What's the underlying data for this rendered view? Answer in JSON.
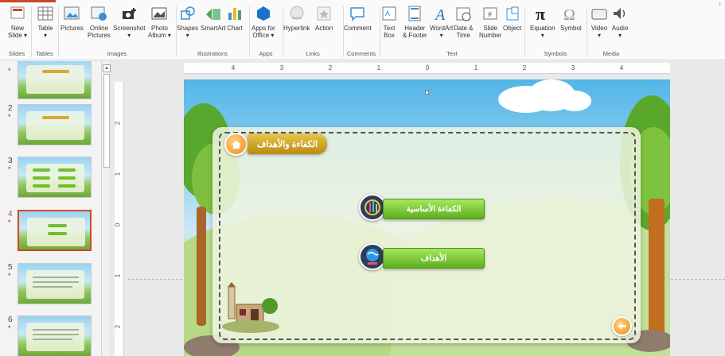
{
  "ribbon": {
    "groups": [
      {
        "name": "slides",
        "label": "Slides",
        "buttons": [
          {
            "label": "New",
            "label2": "Slide ▾",
            "icon": "new-slide-icon"
          }
        ]
      },
      {
        "name": "tables",
        "label": "Tables",
        "buttons": [
          {
            "label": "Table",
            "label2": "▾",
            "icon": "table-icon"
          }
        ]
      },
      {
        "name": "images",
        "label": "Images",
        "buttons": [
          {
            "label": "Pictures",
            "label2": "",
            "icon": "pictures-icon"
          },
          {
            "label": "Online",
            "label2": "Pictures",
            "icon": "online-pictures-icon"
          },
          {
            "label": "Screenshot",
            "label2": "▾",
            "icon": "screenshot-icon"
          },
          {
            "label": "Photo",
            "label2": "Album ▾",
            "icon": "photo-album-icon"
          }
        ]
      },
      {
        "name": "illustrations",
        "label": "Illustrations",
        "buttons": [
          {
            "label": "Shapes",
            "label2": "▾",
            "icon": "shapes-icon"
          },
          {
            "label": "SmartArt",
            "label2": "",
            "icon": "smartart-icon"
          },
          {
            "label": "Chart",
            "label2": "",
            "icon": "chart-icon"
          }
        ]
      },
      {
        "name": "apps",
        "label": "Apps",
        "buttons": [
          {
            "label": "Apps for",
            "label2": "Office ▾",
            "icon": "apps-icon"
          }
        ]
      },
      {
        "name": "links",
        "label": "Links",
        "buttons": [
          {
            "label": "Hyperlink",
            "label2": "",
            "icon": "hyperlink-icon"
          },
          {
            "label": "Action",
            "label2": "",
            "icon": "action-icon"
          }
        ]
      },
      {
        "name": "comments",
        "label": "Comments",
        "buttons": [
          {
            "label": "Comment",
            "label2": "",
            "icon": "comment-icon"
          }
        ]
      },
      {
        "name": "text",
        "label": "Text",
        "buttons": [
          {
            "label": "Text",
            "label2": "Box",
            "icon": "text-box-icon"
          },
          {
            "label": "Header",
            "label2": "& Footer",
            "icon": "header-footer-icon"
          },
          {
            "label": "WordArt",
            "label2": "▾",
            "icon": "wordart-icon"
          },
          {
            "label": "Date &",
            "label2": "Time",
            "icon": "date-time-icon"
          },
          {
            "label": "Slide",
            "label2": "Number",
            "icon": "slide-number-icon"
          },
          {
            "label": "Object",
            "label2": "",
            "icon": "object-icon"
          }
        ]
      },
      {
        "name": "symbols",
        "label": "Symbols",
        "buttons": [
          {
            "label": "Equation",
            "label2": "▾",
            "icon": "equation-icon"
          },
          {
            "label": "Symbol",
            "label2": "",
            "icon": "symbol-icon"
          }
        ]
      },
      {
        "name": "media",
        "label": "Media",
        "buttons": [
          {
            "label": "Video",
            "label2": "▾",
            "icon": "video-icon"
          },
          {
            "label": "Audio",
            "label2": "▾",
            "icon": "audio-icon"
          }
        ]
      }
    ],
    "tail": "↑"
  },
  "thumbnails": [
    {
      "number": "",
      "star": "*"
    },
    {
      "number": "2",
      "star": "*"
    },
    {
      "number": "3",
      "star": "*"
    },
    {
      "number": "4",
      "star": "*",
      "active": true
    },
    {
      "number": "5",
      "star": "*"
    },
    {
      "number": "6",
      "star": "*"
    }
  ],
  "rulers": {
    "horizontal": [
      "4",
      "3",
      "2",
      "1",
      "0",
      "1",
      "2",
      "3",
      "4"
    ],
    "vertical": [
      "2",
      "1",
      "0",
      "1",
      "2"
    ]
  },
  "slide": {
    "title": "الكفاءة والأهداف",
    "menu": [
      {
        "label": "الكفاءة الأساسية",
        "icon": "competency-icon"
      },
      {
        "label": "الأهداف",
        "icon": "goals-icon"
      }
    ]
  },
  "colors": {
    "accent": "#c9472a",
    "active_border": "#d24726",
    "button_green": "#5dae1f",
    "banner_gold": "#b98a13",
    "orange": "#f08a1b"
  }
}
